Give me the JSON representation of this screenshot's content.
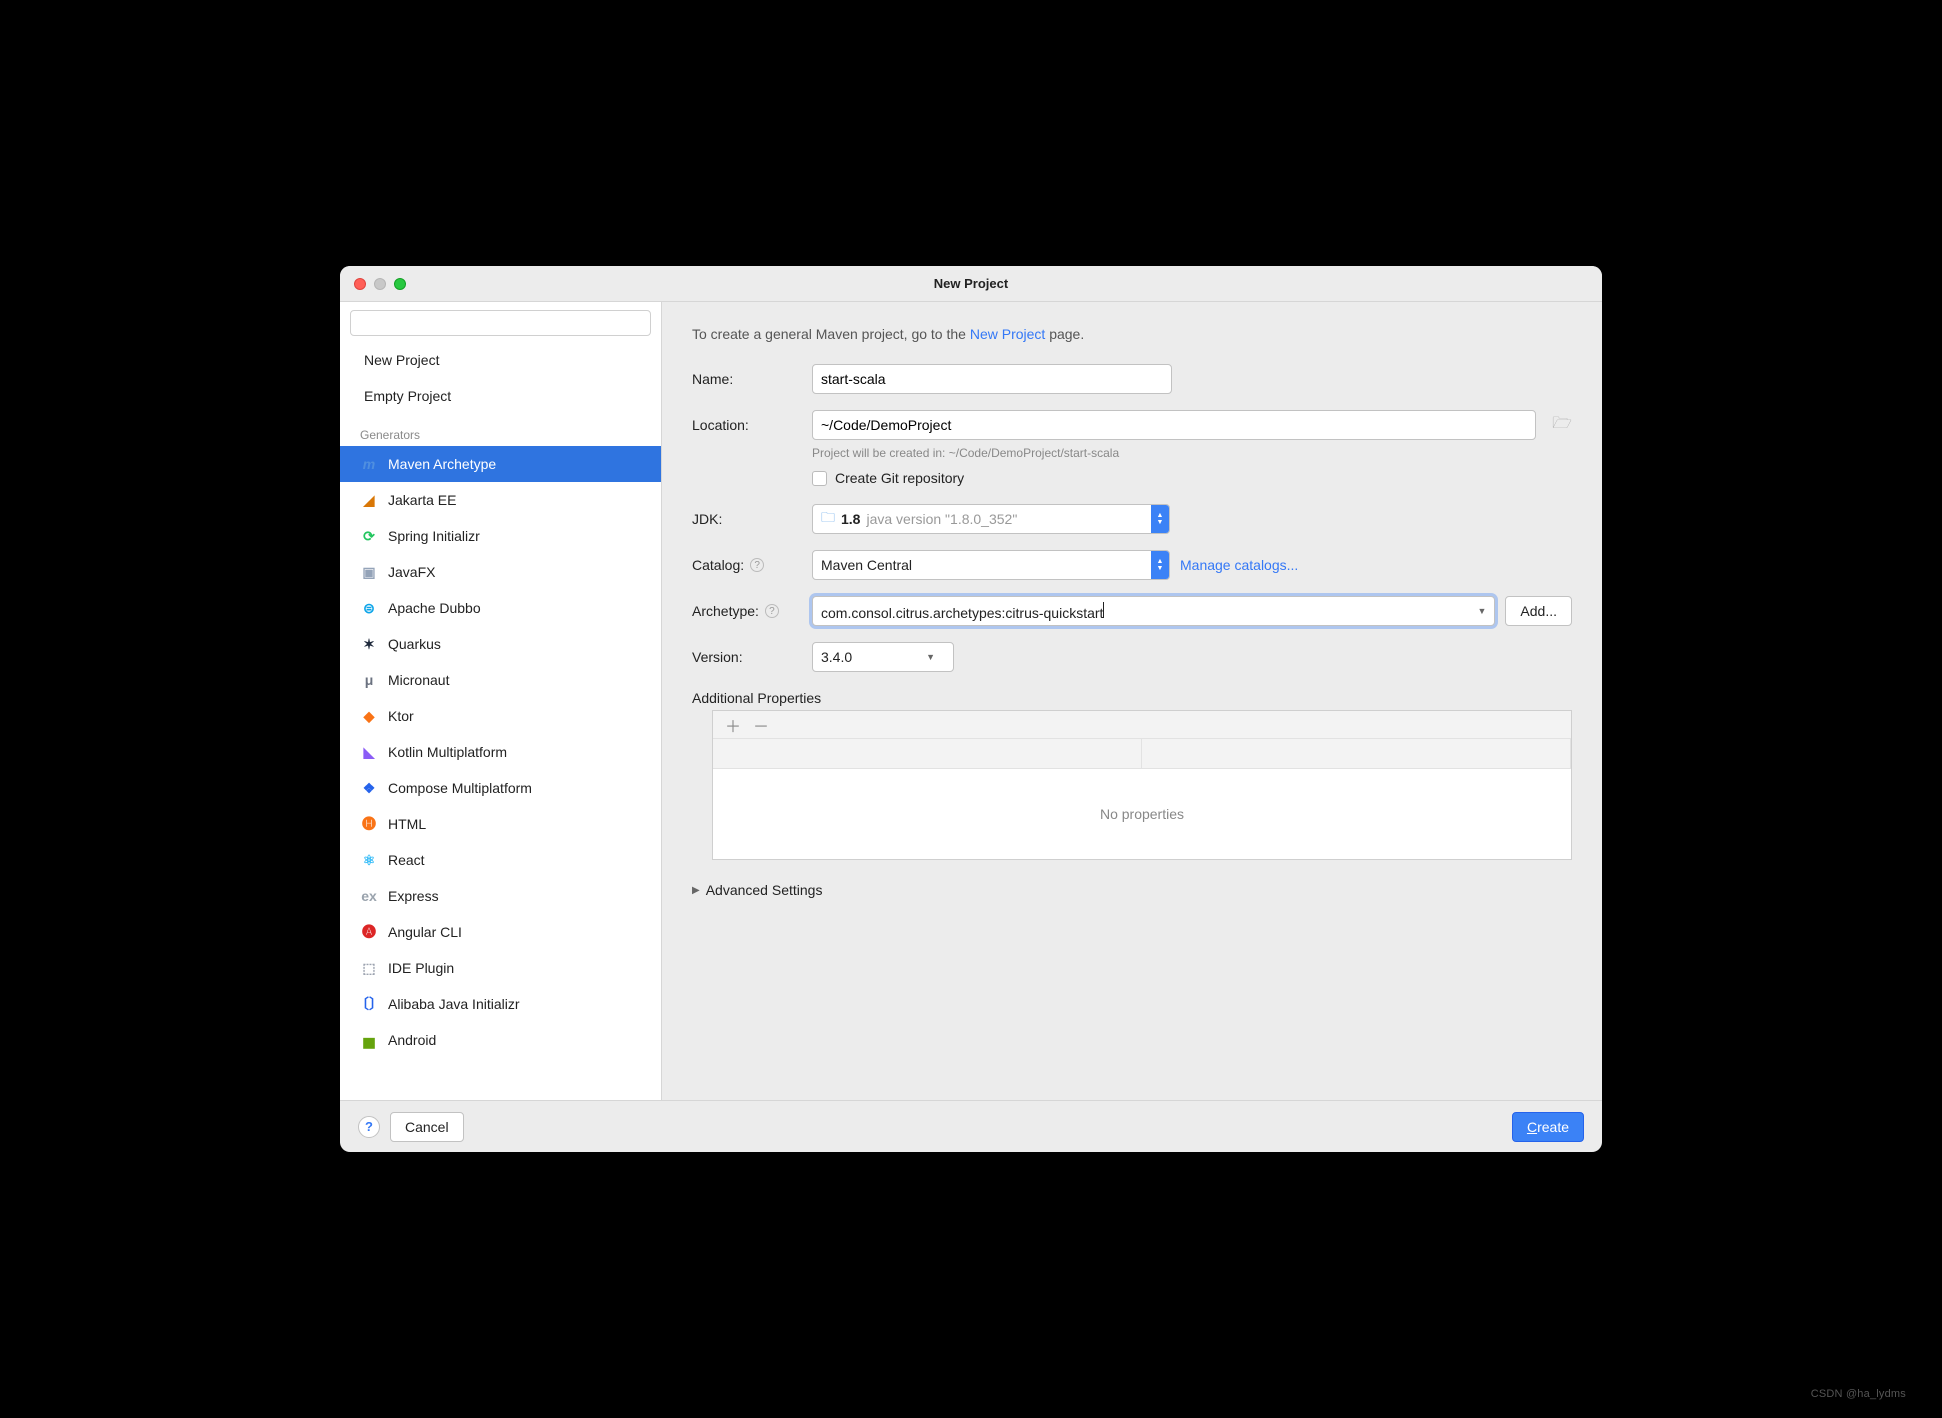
{
  "window": {
    "title": "New Project"
  },
  "search": {
    "placeholder": ""
  },
  "sidebar": {
    "top": [
      {
        "label": "New Project"
      },
      {
        "label": "Empty Project"
      }
    ],
    "heading": "Generators",
    "generators": [
      {
        "label": "Maven Archetype",
        "icon": "maven-icon",
        "color": "#4f8fe0",
        "glyph": "m",
        "selected": true
      },
      {
        "label": "Jakarta EE",
        "icon": "jakarta-icon",
        "color": "#d97706",
        "glyph": "◢"
      },
      {
        "label": "Spring Initializr",
        "icon": "spring-icon",
        "color": "#22c55e",
        "glyph": "⟳"
      },
      {
        "label": "JavaFX",
        "icon": "javafx-icon",
        "color": "#94a3b8",
        "glyph": "▣"
      },
      {
        "label": "Apache Dubbo",
        "icon": "dubbo-icon",
        "color": "#0ea5e9",
        "glyph": "⊜"
      },
      {
        "label": "Quarkus",
        "icon": "quarkus-icon",
        "color": "#1e293b",
        "glyph": "✶"
      },
      {
        "label": "Micronaut",
        "icon": "micronaut-icon",
        "color": "#6b7280",
        "glyph": "μ"
      },
      {
        "label": "Ktor",
        "icon": "ktor-icon",
        "color": "#f97316",
        "glyph": "◆"
      },
      {
        "label": "Kotlin Multiplatform",
        "icon": "kotlin-icon",
        "color": "#8b5cf6",
        "glyph": "◣"
      },
      {
        "label": "Compose Multiplatform",
        "icon": "compose-icon",
        "color": "#2563eb",
        "glyph": "❖"
      },
      {
        "label": "HTML",
        "icon": "html-icon",
        "color": "#f97316",
        "glyph": "🅗"
      },
      {
        "label": "React",
        "icon": "react-icon",
        "color": "#38bdf8",
        "glyph": "⚛"
      },
      {
        "label": "Express",
        "icon": "express-icon",
        "color": "#9aa3ad",
        "glyph": "ex"
      },
      {
        "label": "Angular CLI",
        "icon": "angular-icon",
        "color": "#dc2626",
        "glyph": "🅐"
      },
      {
        "label": "IDE Plugin",
        "icon": "ideplugin-icon",
        "color": "#9ca3af",
        "glyph": "⬚"
      },
      {
        "label": "Alibaba Java Initializr",
        "icon": "alibaba-icon",
        "color": "#2563eb",
        "glyph": "〔〕"
      },
      {
        "label": "Android",
        "icon": "android-icon",
        "color": "#65a30d",
        "glyph": "▅"
      }
    ]
  },
  "form": {
    "intro_prefix": "To create a general Maven project, go to the ",
    "intro_link": "New Project",
    "intro_suffix": " page.",
    "name_label": "Name:",
    "name_value": "start-scala",
    "location_label": "Location:",
    "location_value": "~/Code/DemoProject",
    "location_hint": "Project will be created in: ~/Code/DemoProject/start-scala",
    "git_label": "Create Git repository",
    "jdk_label": "JDK:",
    "jdk_value": "1.8",
    "jdk_detail": "java version \"1.8.0_352\"",
    "catalog_label": "Catalog:",
    "catalog_value": "Maven Central",
    "manage_catalogs": "Manage catalogs...",
    "archetype_label": "Archetype:",
    "archetype_value": "com.consol.citrus.archetypes:citrus-quickstart",
    "add_label": "Add...",
    "version_label": "Version:",
    "version_value": "3.4.0",
    "additional_title": "Additional Properties",
    "no_properties": "No properties",
    "advanced_label": "Advanced Settings"
  },
  "footer": {
    "cancel": "Cancel",
    "create": "Create"
  },
  "watermark": "CSDN @ha_lydms"
}
